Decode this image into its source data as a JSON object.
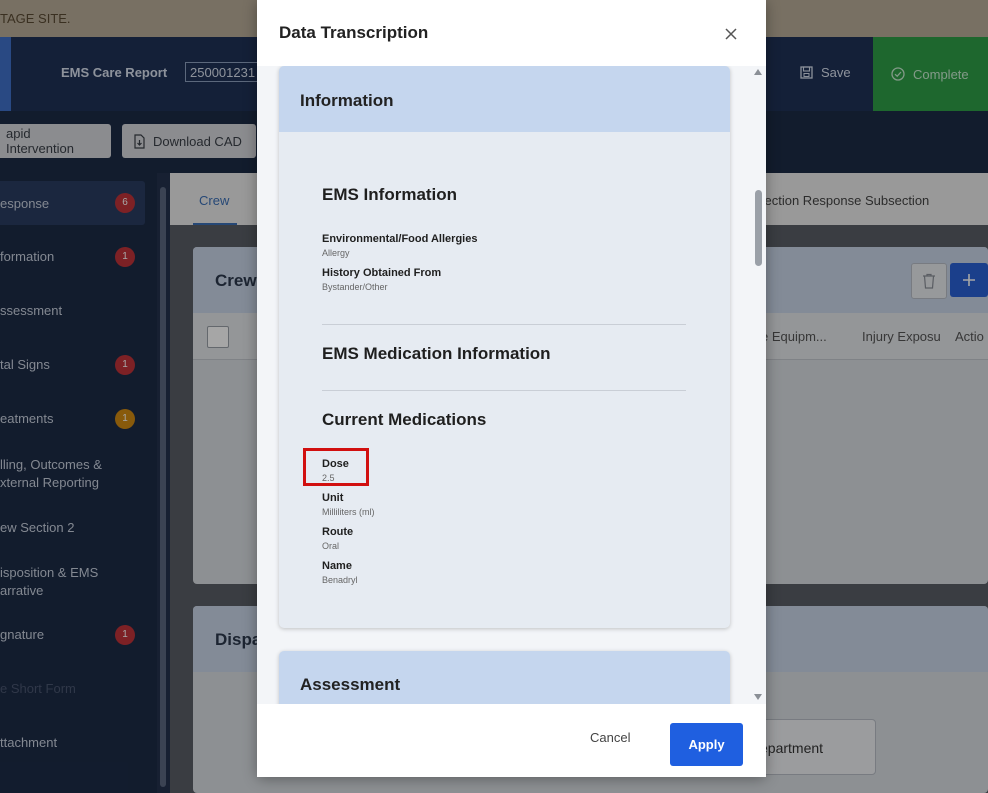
{
  "banner": {
    "text": "TAGE SITE."
  },
  "header": {
    "report_label": "EMS Care Report",
    "report_number": "250001231",
    "save_label": "Save",
    "complete_label": "Complete"
  },
  "toolbar": {
    "rapid_intervention_label": "apid Intervention",
    "download_cad_label": "Download CAD"
  },
  "sidebar": {
    "items": [
      {
        "label": "esponse",
        "badge": "6"
      },
      {
        "label": "formation",
        "badge": "1"
      },
      {
        "label": "ssessment",
        "badge": ""
      },
      {
        "label": "tal Signs",
        "badge": "1"
      },
      {
        "label": "eatments",
        "badge": "1"
      },
      {
        "label": "lling, Outcomes & xternal Reporting",
        "badge": ""
      },
      {
        "label": "ew Section 2",
        "badge": ""
      },
      {
        "label": "isposition & EMS arrative",
        "badge": ""
      },
      {
        "label": "gnature",
        "badge": "1"
      },
      {
        "label": "e Short Form",
        "badge": ""
      },
      {
        "label": "ttachment",
        "badge": ""
      }
    ]
  },
  "background": {
    "tab_crew": "Crew",
    "tab_subsection": "section Response Subsection",
    "crew_panel_title": "Crew",
    "grid_col_equipment": "e Equipm...",
    "grid_col_injury": "Injury Exposu",
    "grid_col_action": "Actio",
    "dispatch_panel_title": "Dispa",
    "department_button": "epartment"
  },
  "modal": {
    "title": "Data Transcription",
    "sections": {
      "information": {
        "title": "Information",
        "ems_information": {
          "title": "EMS Information",
          "fields": [
            {
              "label": "Environmental/Food Allergies",
              "value": "Allergy"
            },
            {
              "label": "History Obtained From",
              "value": "Bystander/Other"
            }
          ]
        },
        "ems_medication_information": {
          "title": "EMS Medication Information"
        },
        "current_medications": {
          "title": "Current Medications",
          "fields": [
            {
              "label": "Dose",
              "value": "2.5"
            },
            {
              "label": "Unit",
              "value": "Milliliters (ml)"
            },
            {
              "label": "Route",
              "value": "Oral"
            },
            {
              "label": "Name",
              "value": "Benadryl"
            }
          ]
        }
      },
      "assessment": {
        "title": "Assessment"
      }
    },
    "cancel_label": "Cancel",
    "apply_label": "Apply"
  },
  "colors": {
    "apply_button": "#1f5fe0",
    "complete_button": "#2f9e47",
    "section_header": "#c5d6ee",
    "highlight": "#d10f0f",
    "badge_red": "#c0343a",
    "badge_orange": "#d28a12"
  },
  "icons": {
    "close": "close-icon",
    "save": "save-icon",
    "complete": "check-circle-icon",
    "download": "download-icon",
    "trash": "trash-icon",
    "add": "plus-icon"
  }
}
